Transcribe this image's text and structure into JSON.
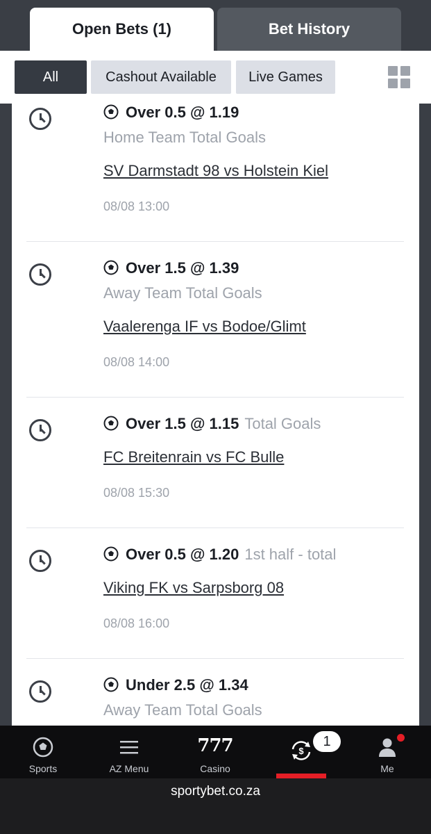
{
  "tabs": [
    {
      "label": "Open Bets (1)",
      "active": true
    },
    {
      "label": "Bet History",
      "active": false
    }
  ],
  "filters": [
    {
      "label": "All",
      "active": true
    },
    {
      "label": "Cashout Available",
      "active": false
    },
    {
      "label": "Live Games",
      "active": false
    }
  ],
  "bets": [
    {
      "selection": "Over 0.5 @ 1.19",
      "market": "Home Team Total Goals",
      "market_inline": false,
      "match": "SV Darmstadt 98 vs Holstein Kiel",
      "datetime": "08/08 13:00"
    },
    {
      "selection": "Over 1.5 @ 1.39",
      "market": "Away Team Total Goals",
      "market_inline": false,
      "match": "Vaalerenga IF vs Bodoe/Glimt",
      "datetime": "08/08 14:00"
    },
    {
      "selection": "Over 1.5 @ 1.15",
      "market": "Total Goals",
      "market_inline": true,
      "match": "FC Breitenrain vs FC Bulle",
      "datetime": "08/08 15:30"
    },
    {
      "selection": "Over 0.5 @ 1.20",
      "market": "1st half - total",
      "market_inline": true,
      "match": "Viking FK vs Sarpsborg 08",
      "datetime": "08/08 16:00"
    },
    {
      "selection": "Under 2.5 @ 1.34",
      "market": "Away Team Total Goals",
      "market_inline": false,
      "match": "",
      "datetime": ""
    }
  ],
  "nav": [
    {
      "label": "Sports",
      "icon": "soccer-ball-icon"
    },
    {
      "label": "AZ Menu",
      "icon": "hamburger-menu-icon"
    },
    {
      "label": "Casino",
      "icon": "casino-777-icon",
      "icon_text": "777"
    },
    {
      "label": "",
      "icon": "open-bets-cashout-icon",
      "badge": "1",
      "active": true
    },
    {
      "label": "Me",
      "icon": "user-icon",
      "notification": true
    }
  ],
  "colors": {
    "accent": "#e41e26",
    "header_bg": "#3a3e45",
    "chip_active": "#353a42",
    "chip_inactive": "#dcdfe6",
    "muted": "#9ea3ab"
  },
  "url": "sportybet.co.za"
}
